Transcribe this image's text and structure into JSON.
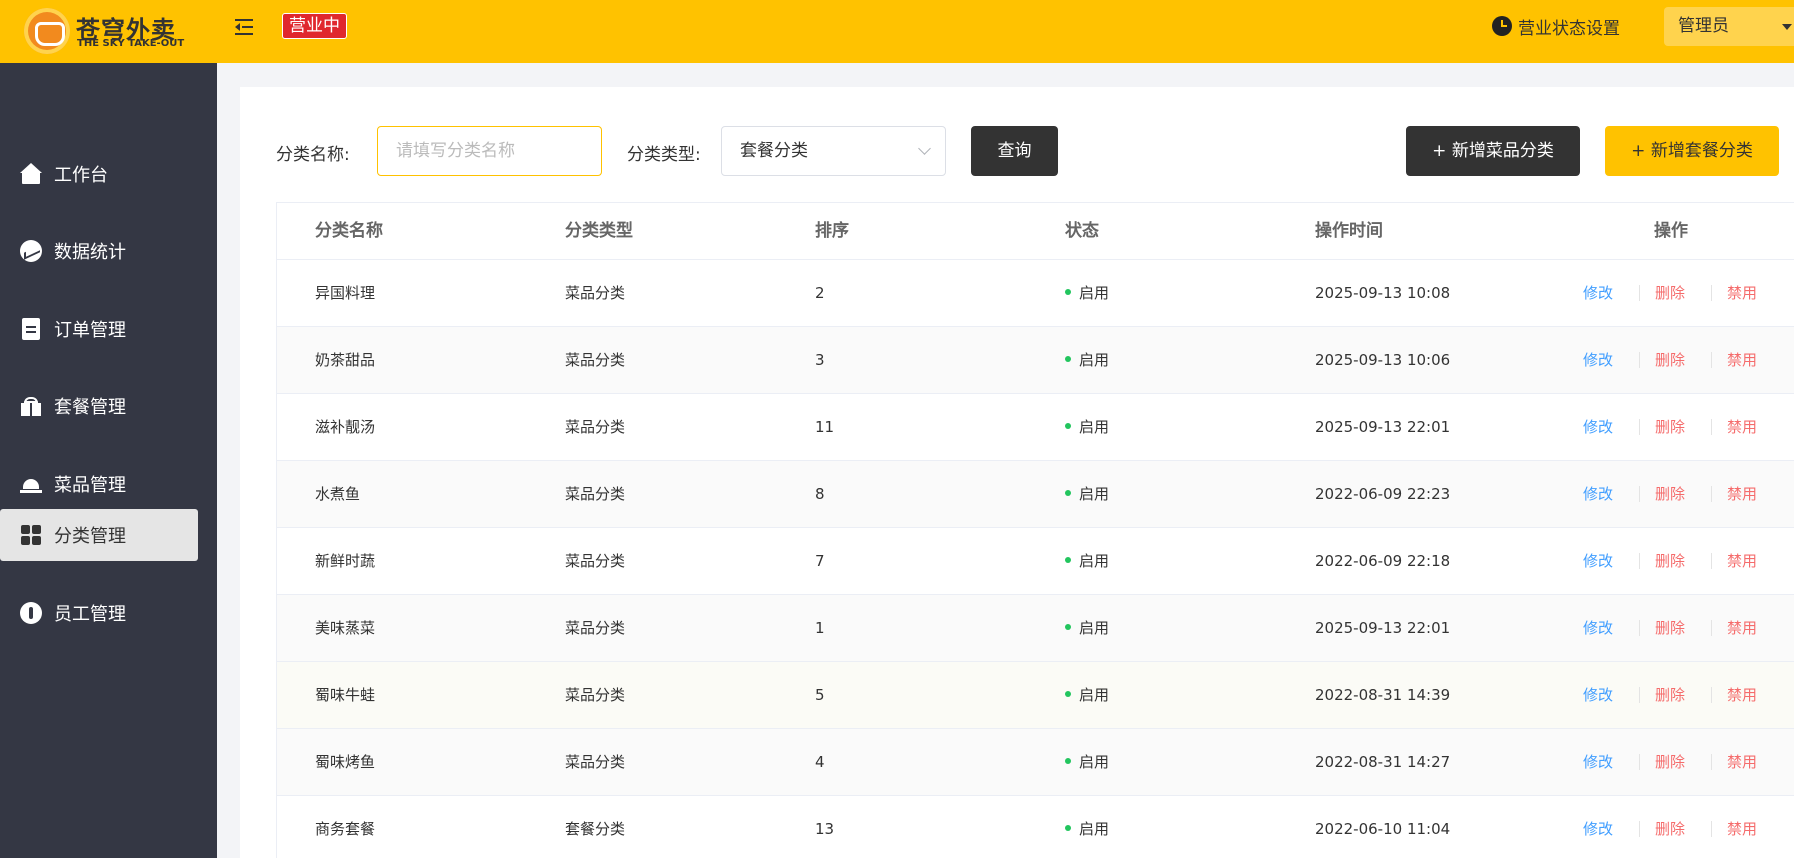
{
  "header": {
    "logo_cn": "苍穹外卖",
    "logo_en": "THE SKY TAKE-OUT",
    "status_badge": "营业中",
    "biz_setting": "营业状态设置",
    "admin": "管理员"
  },
  "sidebar": {
    "items": [
      {
        "label": "工作台",
        "icon": "home-icon"
      },
      {
        "label": "数据统计",
        "icon": "chart-icon"
      },
      {
        "label": "订单管理",
        "icon": "clipboard-icon"
      },
      {
        "label": "套餐管理",
        "icon": "gift-icon"
      },
      {
        "label": "菜品管理",
        "icon": "dish-icon"
      },
      {
        "label": "分类管理",
        "icon": "grid-icon",
        "active": true
      },
      {
        "label": "员工管理",
        "icon": "employee-icon"
      }
    ]
  },
  "filter": {
    "name_label": "分类名称:",
    "name_placeholder": "请填写分类名称",
    "type_label": "分类类型:",
    "type_value": "套餐分类",
    "query_button": "查询",
    "add_dish_button": "+ 新增菜品分类",
    "add_setmeal_button": "+ 新增套餐分类"
  },
  "table": {
    "headers": [
      "分类名称",
      "分类类型",
      "排序",
      "状态",
      "操作时间",
      "操作"
    ],
    "actions": {
      "edit": "修改",
      "delete": "删除",
      "disable": "禁用"
    },
    "rows": [
      {
        "name": "异国料理",
        "type": "菜品分类",
        "sort": "2",
        "status": "启用",
        "time": "2025-09-13 10:08"
      },
      {
        "name": "奶茶甜品",
        "type": "菜品分类",
        "sort": "3",
        "status": "启用",
        "time": "2025-09-13 10:06"
      },
      {
        "name": "滋补靓汤",
        "type": "菜品分类",
        "sort": "11",
        "status": "启用",
        "time": "2025-09-13 22:01"
      },
      {
        "name": "水煮鱼",
        "type": "菜品分类",
        "sort": "8",
        "status": "启用",
        "time": "2022-06-09 22:23"
      },
      {
        "name": "新鲜时蔬",
        "type": "菜品分类",
        "sort": "7",
        "status": "启用",
        "time": "2022-06-09 22:18"
      },
      {
        "name": "美味蒸菜",
        "type": "菜品分类",
        "sort": "1",
        "status": "启用",
        "time": "2025-09-13 22:01"
      },
      {
        "name": "蜀味牛蛙",
        "type": "菜品分类",
        "sort": "5",
        "status": "启用",
        "time": "2022-08-31 14:39"
      },
      {
        "name": "蜀味烤鱼",
        "type": "菜品分类",
        "sort": "4",
        "status": "启用",
        "time": "2022-08-31 14:27"
      },
      {
        "name": "商务套餐",
        "type": "套餐分类",
        "sort": "13",
        "status": "启用",
        "time": "2022-06-10 11:04"
      }
    ]
  },
  "colors": {
    "brand": "#ffc200",
    "sidebar_bg": "#343744",
    "badge_red": "#e0282d",
    "link_blue": "#419eff",
    "danger_red": "#f56c6c",
    "status_green": "#22c55e"
  }
}
